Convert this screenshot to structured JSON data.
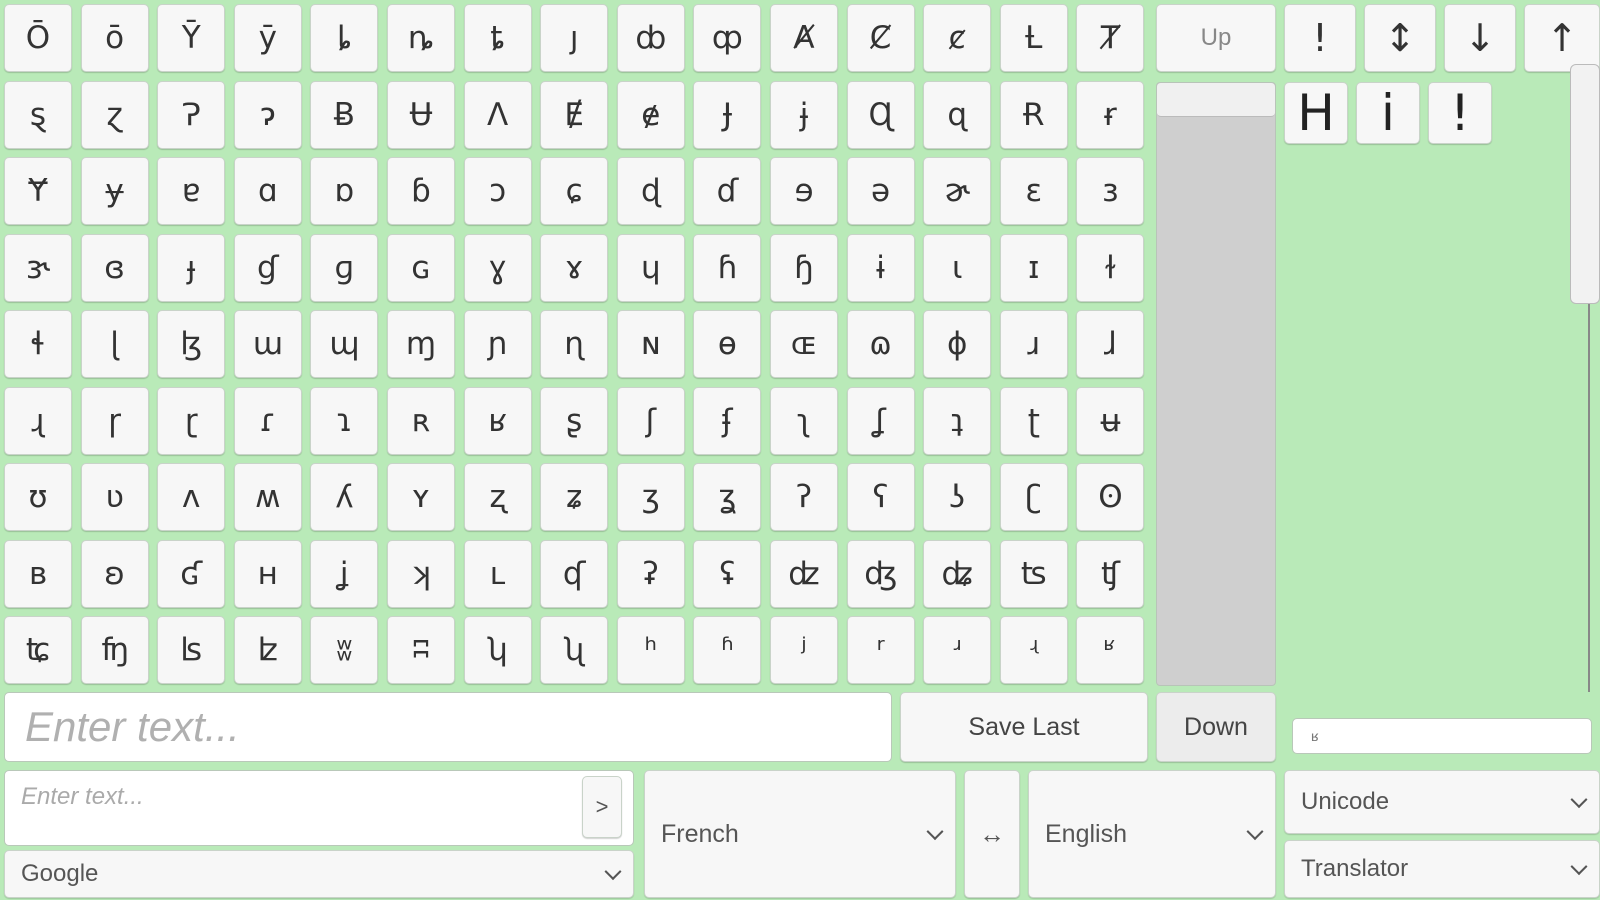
{
  "keyboard": {
    "rows": [
      [
        "Ō",
        "ō",
        "Ȳ",
        "ȳ",
        "ȴ",
        "ȵ",
        "ȶ",
        "ȷ",
        "ȸ",
        "ȹ",
        "Ⱥ",
        "Ȼ",
        "ȼ",
        "Ƚ",
        "Ⱦ"
      ],
      [
        "ȿ",
        "ɀ",
        "Ɂ",
        "ɂ",
        "Ƀ",
        "Ʉ",
        "Ʌ",
        "Ɇ",
        "ɇ",
        "Ɉ",
        "ɉ",
        "Ɋ",
        "ɋ",
        "Ɍ",
        "ɍ"
      ],
      [
        "Ɏ",
        "ɏ",
        "ɐ",
        "ɑ",
        "ɒ",
        "ɓ",
        "ɔ",
        "ɕ",
        "ɖ",
        "ɗ",
        "ɘ",
        "ə",
        "ɚ",
        "ɛ",
        "ɜ"
      ],
      [
        "ɝ",
        "ɞ",
        "ɟ",
        "ɠ",
        "ɡ",
        "ɢ",
        "ɣ",
        "ɤ",
        "ɥ",
        "ɦ",
        "ɧ",
        "ɨ",
        "ɩ",
        "ɪ",
        "ɫ"
      ],
      [
        "ɬ",
        "ɭ",
        "ɮ",
        "ɯ",
        "ɰ",
        "ɱ",
        "ɲ",
        "ɳ",
        "ɴ",
        "ɵ",
        "ɶ",
        "ɷ",
        "ɸ",
        "ɹ",
        "ɺ"
      ],
      [
        "ɻ",
        "ɼ",
        "ɽ",
        "ɾ",
        "ɿ",
        "ʀ",
        "ʁ",
        "ʂ",
        "ʃ",
        "ʄ",
        "ʅ",
        "ʆ",
        "ʇ",
        "ʈ",
        "ʉ"
      ],
      [
        "ʊ",
        "ʋ",
        "ʌ",
        "ʍ",
        "ʎ",
        "ʏ",
        "ʐ",
        "ʑ",
        "ʒ",
        "ʓ",
        "ʔ",
        "ʕ",
        "ʖ",
        "ʗ",
        "ʘ"
      ],
      [
        "ʙ",
        "ʚ",
        "ʛ",
        "ʜ",
        "ʝ",
        "ʞ",
        "ʟ",
        "ʠ",
        "ʡ",
        "ʢ",
        "ʣ",
        "ʤ",
        "ʥ",
        "ʦ",
        "ʧ"
      ],
      [
        "ʨ",
        "ʩ",
        "ʪ",
        "ʫ",
        "ʬ",
        "ʭ",
        "ʮ",
        "ʯ",
        "ʰ",
        "ʱ",
        "ʲ",
        "ʳ",
        "ʴ",
        "ʵ",
        "ʶ"
      ]
    ]
  },
  "nav": {
    "up_label": "Up",
    "down_label": "Down",
    "save_label": "Save Last"
  },
  "main_input": {
    "placeholder": "Enter text...",
    "value": ""
  },
  "side_keys": {
    "keys": [
      "!",
      "↕",
      "↓",
      "↑"
    ]
  },
  "output": {
    "chars": [
      "H",
      "i",
      "!"
    ]
  },
  "side_input": {
    "value": "ʁ"
  },
  "translate": {
    "placeholder": "Enter text...",
    "send_label": ">",
    "swap_label": "↔",
    "source_lang": "French",
    "target_lang": "English",
    "engine": "Google"
  },
  "mode_selects": {
    "encoding": "Unicode",
    "tool": "Translator"
  }
}
